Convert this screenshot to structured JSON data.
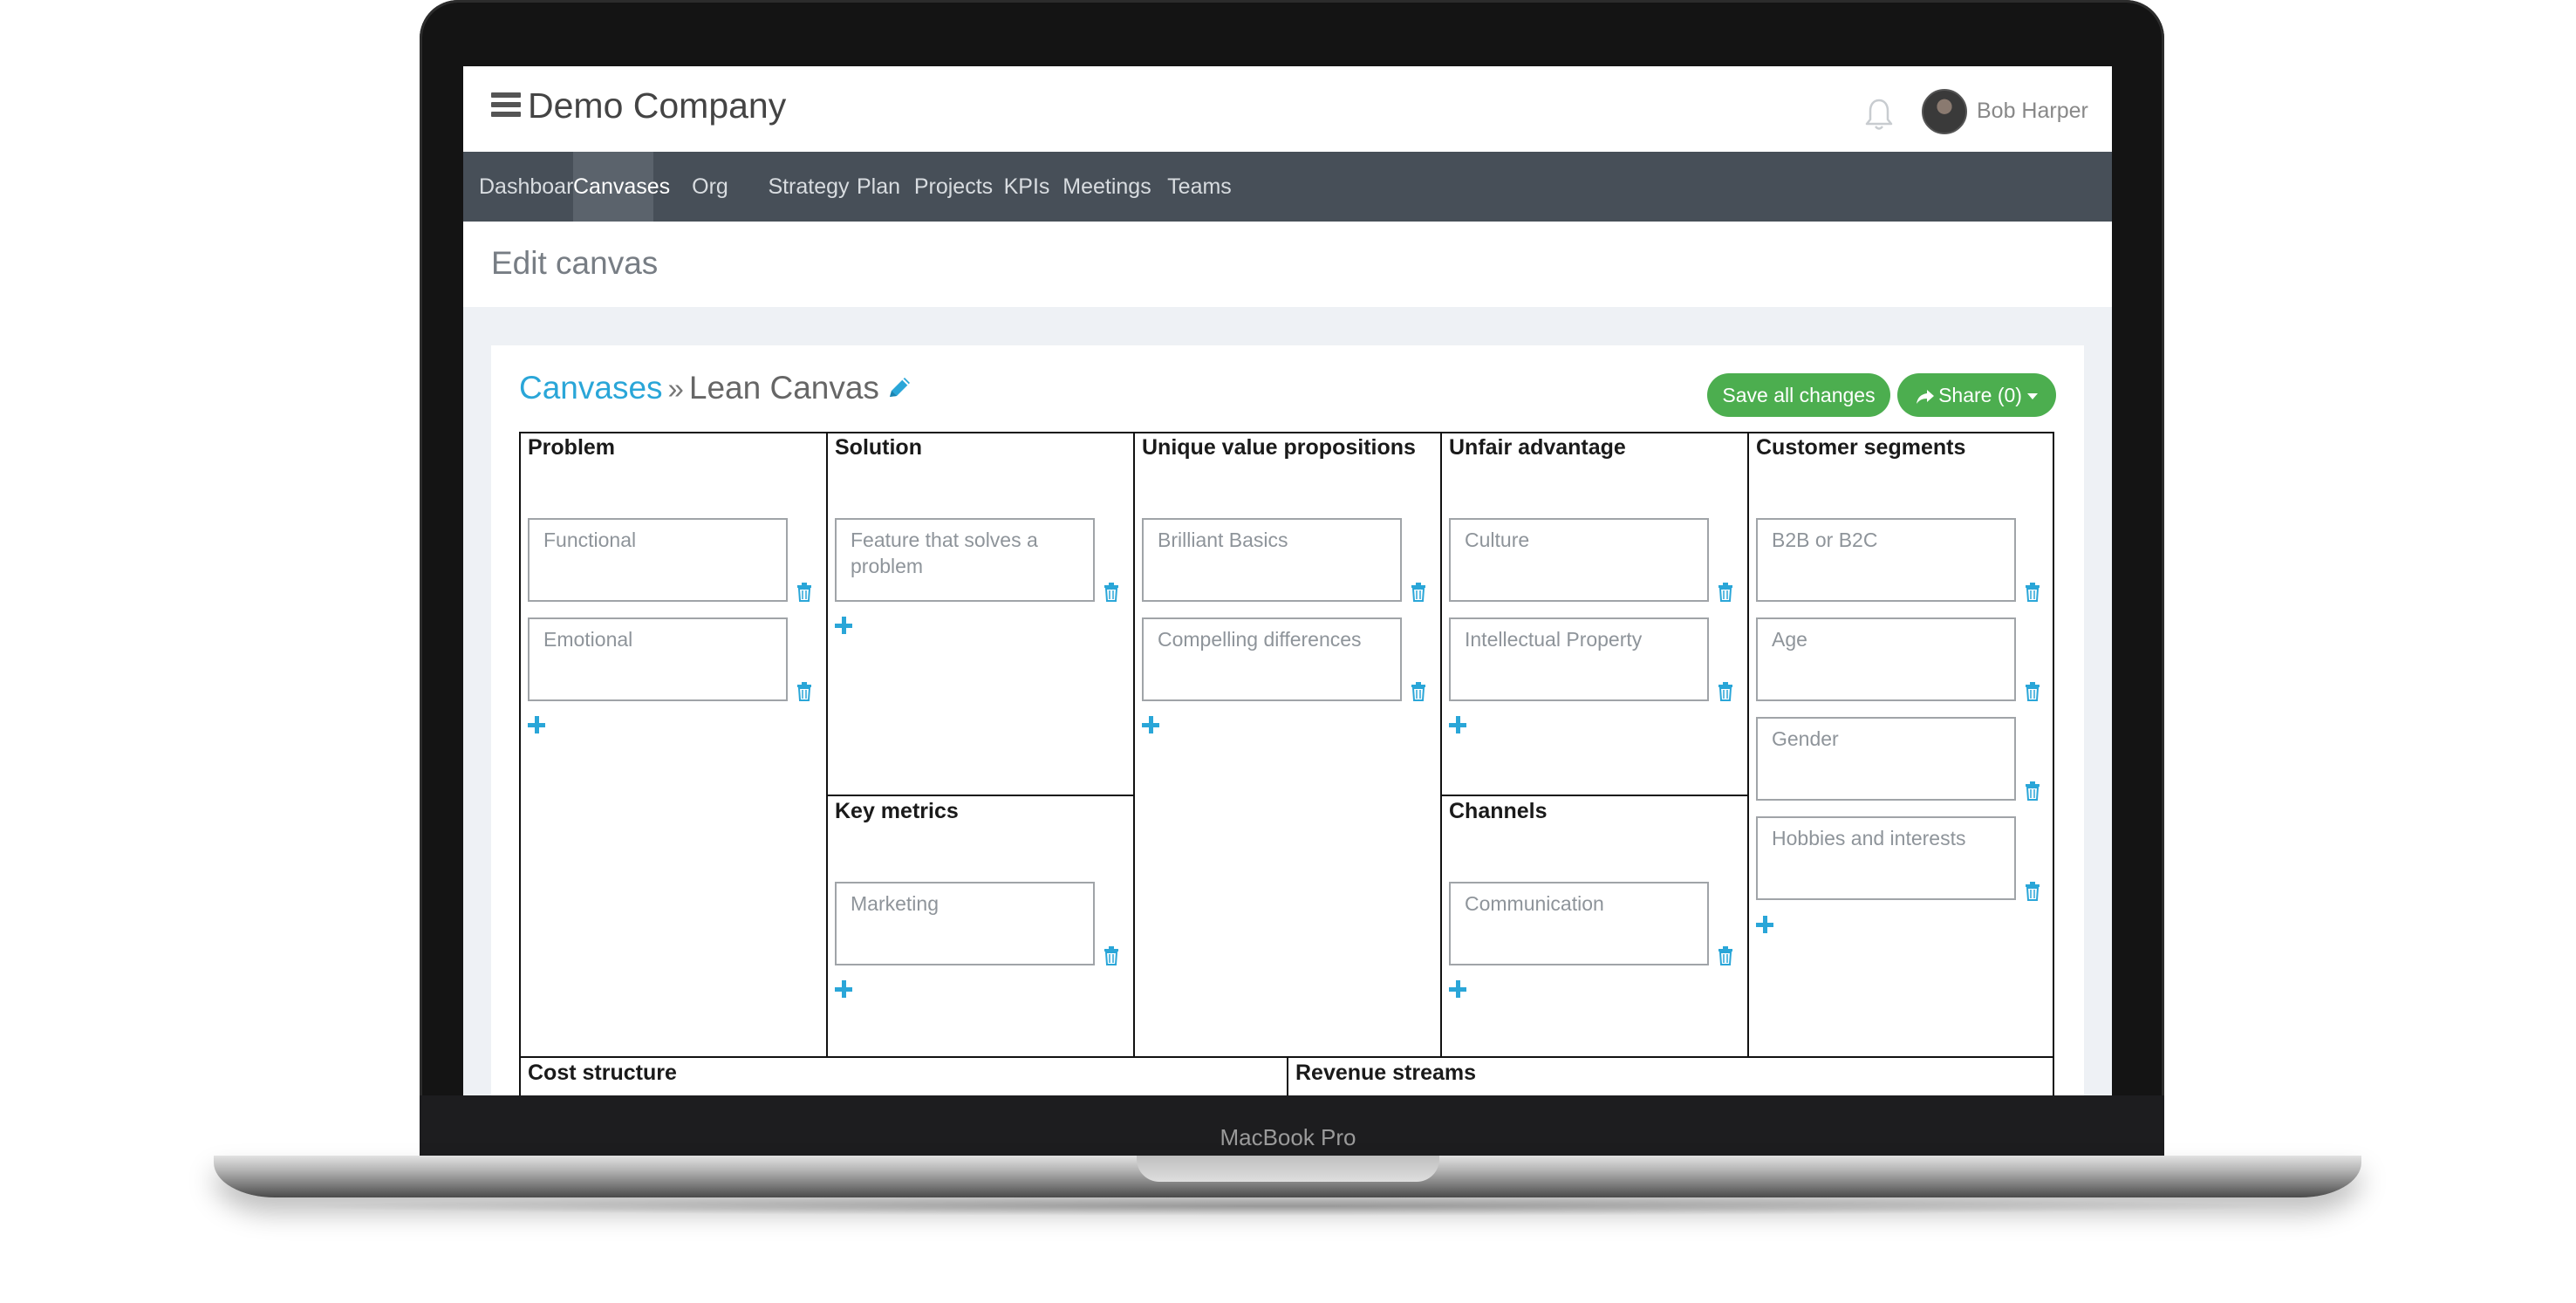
{
  "device": {
    "label": "MacBook Pro"
  },
  "header": {
    "company": "Demo Company",
    "user": "Bob Harper"
  },
  "nav": {
    "items": [
      {
        "label": "Dashboard"
      },
      {
        "label": "Canvases",
        "active": true
      },
      {
        "label": "Org Charts"
      },
      {
        "label": "Strategy"
      },
      {
        "label": "Plan"
      },
      {
        "label": "Projects"
      },
      {
        "label": "KPIs"
      },
      {
        "label": "Meetings"
      },
      {
        "label": "Teams"
      }
    ]
  },
  "page": {
    "title": "Edit canvas"
  },
  "breadcrumb": {
    "root": "Canvases",
    "separator": "»",
    "current": "Lean Canvas"
  },
  "actions": {
    "save": "Save all changes",
    "share": "Share (0)"
  },
  "colors": {
    "accent": "#2aa6d8",
    "button": "#4cae4f",
    "navbar": "#474f58"
  },
  "canvas": {
    "problem": {
      "title": "Problem",
      "notes": [
        "Functional",
        "Emotional"
      ]
    },
    "solution": {
      "title": "Solution",
      "notes": [
        "Feature that solves a problem"
      ]
    },
    "key_metrics": {
      "title": "Key metrics",
      "notes": [
        "Marketing"
      ]
    },
    "uvp": {
      "title": "Unique value propositions",
      "notes": [
        "Brilliant Basics",
        "Compelling differences"
      ]
    },
    "unfair_advantage": {
      "title": "Unfair advantage",
      "notes": [
        "Culture",
        "Intellectual Property"
      ]
    },
    "channels": {
      "title": "Channels",
      "notes": [
        "Communication"
      ]
    },
    "customer_segments": {
      "title": "Customer segments",
      "notes": [
        "B2B or B2C",
        "Age",
        "Gender",
        "Hobbies and interests"
      ]
    },
    "cost_structure": {
      "title": "Cost structure"
    },
    "revenue_streams": {
      "title": "Revenue streams"
    }
  }
}
